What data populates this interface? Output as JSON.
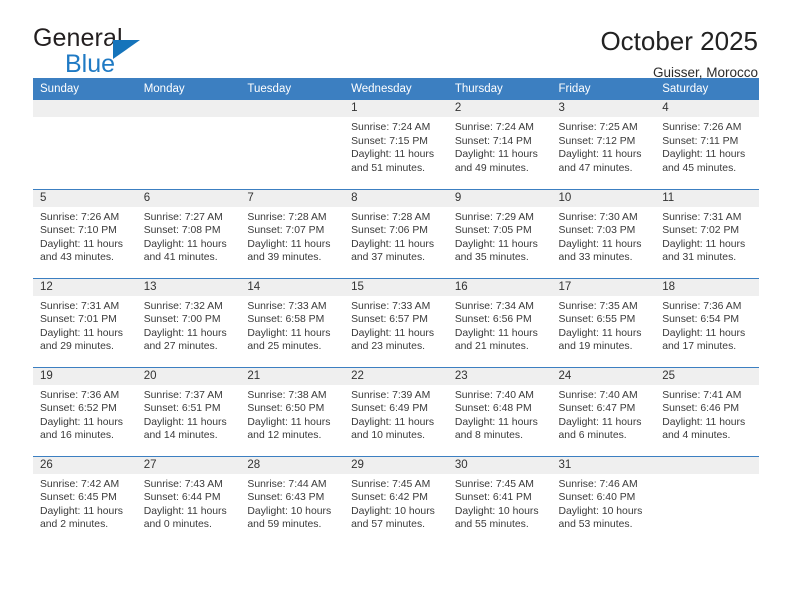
{
  "brand": {
    "name_part1": "General",
    "name_part2": "Blue",
    "triangle_color": "#1574bb",
    "blue_color": "#1f7ac4"
  },
  "header": {
    "title": "October 2025",
    "location": "Guisser, Morocco"
  },
  "theme": {
    "header_blue": "#3c7fc1",
    "daynum_band": "#efefef",
    "text": "#3a3a3a"
  },
  "weekday_headers": [
    "Sunday",
    "Monday",
    "Tuesday",
    "Wednesday",
    "Thursday",
    "Friday",
    "Saturday"
  ],
  "labels": {
    "sunrise_prefix": "Sunrise:",
    "sunset_prefix": "Sunset:",
    "daylight_prefix": "Daylight:"
  },
  "weeks": [
    [
      {
        "day": "",
        "sunrise": "",
        "sunset": "",
        "daylight_line1": "",
        "daylight_line2": ""
      },
      {
        "day": "",
        "sunrise": "",
        "sunset": "",
        "daylight_line1": "",
        "daylight_line2": ""
      },
      {
        "day": "",
        "sunrise": "",
        "sunset": "",
        "daylight_line1": "",
        "daylight_line2": ""
      },
      {
        "day": "1",
        "sunrise": "Sunrise: 7:24 AM",
        "sunset": "Sunset: 7:15 PM",
        "daylight_line1": "Daylight: 11 hours",
        "daylight_line2": "and 51 minutes."
      },
      {
        "day": "2",
        "sunrise": "Sunrise: 7:24 AM",
        "sunset": "Sunset: 7:14 PM",
        "daylight_line1": "Daylight: 11 hours",
        "daylight_line2": "and 49 minutes."
      },
      {
        "day": "3",
        "sunrise": "Sunrise: 7:25 AM",
        "sunset": "Sunset: 7:12 PM",
        "daylight_line1": "Daylight: 11 hours",
        "daylight_line2": "and 47 minutes."
      },
      {
        "day": "4",
        "sunrise": "Sunrise: 7:26 AM",
        "sunset": "Sunset: 7:11 PM",
        "daylight_line1": "Daylight: 11 hours",
        "daylight_line2": "and 45 minutes."
      }
    ],
    [
      {
        "day": "5",
        "sunrise": "Sunrise: 7:26 AM",
        "sunset": "Sunset: 7:10 PM",
        "daylight_line1": "Daylight: 11 hours",
        "daylight_line2": "and 43 minutes."
      },
      {
        "day": "6",
        "sunrise": "Sunrise: 7:27 AM",
        "sunset": "Sunset: 7:08 PM",
        "daylight_line1": "Daylight: 11 hours",
        "daylight_line2": "and 41 minutes."
      },
      {
        "day": "7",
        "sunrise": "Sunrise: 7:28 AM",
        "sunset": "Sunset: 7:07 PM",
        "daylight_line1": "Daylight: 11 hours",
        "daylight_line2": "and 39 minutes."
      },
      {
        "day": "8",
        "sunrise": "Sunrise: 7:28 AM",
        "sunset": "Sunset: 7:06 PM",
        "daylight_line1": "Daylight: 11 hours",
        "daylight_line2": "and 37 minutes."
      },
      {
        "day": "9",
        "sunrise": "Sunrise: 7:29 AM",
        "sunset": "Sunset: 7:05 PM",
        "daylight_line1": "Daylight: 11 hours",
        "daylight_line2": "and 35 minutes."
      },
      {
        "day": "10",
        "sunrise": "Sunrise: 7:30 AM",
        "sunset": "Sunset: 7:03 PM",
        "daylight_line1": "Daylight: 11 hours",
        "daylight_line2": "and 33 minutes."
      },
      {
        "day": "11",
        "sunrise": "Sunrise: 7:31 AM",
        "sunset": "Sunset: 7:02 PM",
        "daylight_line1": "Daylight: 11 hours",
        "daylight_line2": "and 31 minutes."
      }
    ],
    [
      {
        "day": "12",
        "sunrise": "Sunrise: 7:31 AM",
        "sunset": "Sunset: 7:01 PM",
        "daylight_line1": "Daylight: 11 hours",
        "daylight_line2": "and 29 minutes."
      },
      {
        "day": "13",
        "sunrise": "Sunrise: 7:32 AM",
        "sunset": "Sunset: 7:00 PM",
        "daylight_line1": "Daylight: 11 hours",
        "daylight_line2": "and 27 minutes."
      },
      {
        "day": "14",
        "sunrise": "Sunrise: 7:33 AM",
        "sunset": "Sunset: 6:58 PM",
        "daylight_line1": "Daylight: 11 hours",
        "daylight_line2": "and 25 minutes."
      },
      {
        "day": "15",
        "sunrise": "Sunrise: 7:33 AM",
        "sunset": "Sunset: 6:57 PM",
        "daylight_line1": "Daylight: 11 hours",
        "daylight_line2": "and 23 minutes."
      },
      {
        "day": "16",
        "sunrise": "Sunrise: 7:34 AM",
        "sunset": "Sunset: 6:56 PM",
        "daylight_line1": "Daylight: 11 hours",
        "daylight_line2": "and 21 minutes."
      },
      {
        "day": "17",
        "sunrise": "Sunrise: 7:35 AM",
        "sunset": "Sunset: 6:55 PM",
        "daylight_line1": "Daylight: 11 hours",
        "daylight_line2": "and 19 minutes."
      },
      {
        "day": "18",
        "sunrise": "Sunrise: 7:36 AM",
        "sunset": "Sunset: 6:54 PM",
        "daylight_line1": "Daylight: 11 hours",
        "daylight_line2": "and 17 minutes."
      }
    ],
    [
      {
        "day": "19",
        "sunrise": "Sunrise: 7:36 AM",
        "sunset": "Sunset: 6:52 PM",
        "daylight_line1": "Daylight: 11 hours",
        "daylight_line2": "and 16 minutes."
      },
      {
        "day": "20",
        "sunrise": "Sunrise: 7:37 AM",
        "sunset": "Sunset: 6:51 PM",
        "daylight_line1": "Daylight: 11 hours",
        "daylight_line2": "and 14 minutes."
      },
      {
        "day": "21",
        "sunrise": "Sunrise: 7:38 AM",
        "sunset": "Sunset: 6:50 PM",
        "daylight_line1": "Daylight: 11 hours",
        "daylight_line2": "and 12 minutes."
      },
      {
        "day": "22",
        "sunrise": "Sunrise: 7:39 AM",
        "sunset": "Sunset: 6:49 PM",
        "daylight_line1": "Daylight: 11 hours",
        "daylight_line2": "and 10 minutes."
      },
      {
        "day": "23",
        "sunrise": "Sunrise: 7:40 AM",
        "sunset": "Sunset: 6:48 PM",
        "daylight_line1": "Daylight: 11 hours",
        "daylight_line2": "and 8 minutes."
      },
      {
        "day": "24",
        "sunrise": "Sunrise: 7:40 AM",
        "sunset": "Sunset: 6:47 PM",
        "daylight_line1": "Daylight: 11 hours",
        "daylight_line2": "and 6 minutes."
      },
      {
        "day": "25",
        "sunrise": "Sunrise: 7:41 AM",
        "sunset": "Sunset: 6:46 PM",
        "daylight_line1": "Daylight: 11 hours",
        "daylight_line2": "and 4 minutes."
      }
    ],
    [
      {
        "day": "26",
        "sunrise": "Sunrise: 7:42 AM",
        "sunset": "Sunset: 6:45 PM",
        "daylight_line1": "Daylight: 11 hours",
        "daylight_line2": "and 2 minutes."
      },
      {
        "day": "27",
        "sunrise": "Sunrise: 7:43 AM",
        "sunset": "Sunset: 6:44 PM",
        "daylight_line1": "Daylight: 11 hours",
        "daylight_line2": "and 0 minutes."
      },
      {
        "day": "28",
        "sunrise": "Sunrise: 7:44 AM",
        "sunset": "Sunset: 6:43 PM",
        "daylight_line1": "Daylight: 10 hours",
        "daylight_line2": "and 59 minutes."
      },
      {
        "day": "29",
        "sunrise": "Sunrise: 7:45 AM",
        "sunset": "Sunset: 6:42 PM",
        "daylight_line1": "Daylight: 10 hours",
        "daylight_line2": "and 57 minutes."
      },
      {
        "day": "30",
        "sunrise": "Sunrise: 7:45 AM",
        "sunset": "Sunset: 6:41 PM",
        "daylight_line1": "Daylight: 10 hours",
        "daylight_line2": "and 55 minutes."
      },
      {
        "day": "31",
        "sunrise": "Sunrise: 7:46 AM",
        "sunset": "Sunset: 6:40 PM",
        "daylight_line1": "Daylight: 10 hours",
        "daylight_line2": "and 53 minutes."
      },
      {
        "day": "",
        "sunrise": "",
        "sunset": "",
        "daylight_line1": "",
        "daylight_line2": ""
      }
    ]
  ]
}
